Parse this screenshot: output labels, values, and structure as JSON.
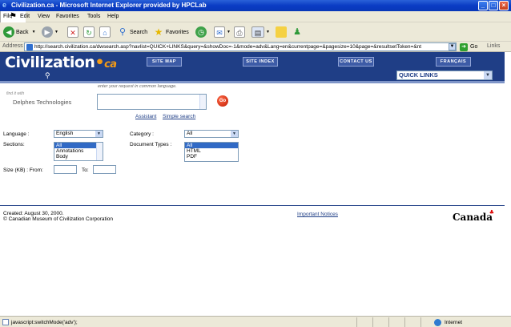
{
  "window": {
    "title": "Civilization.ca - Microsoft Internet Explorer provided by HPCLab"
  },
  "menu": [
    "File",
    "Edit",
    "View",
    "Favorites",
    "Tools",
    "Help"
  ],
  "toolbar": {
    "back": "Back",
    "search": "Search",
    "favorites": "Favorites"
  },
  "address": {
    "label": "Address",
    "url": "http://search.civilization.ca/dwsearch.asp?navlist=QUICK+LINKS&query=&showDoc=-1&mode=adv&Lang=en&currentpage=&pagesize=10&page=&resultsetToken=&nt",
    "go": "Go",
    "links": "Links"
  },
  "header": {
    "logo_main": "Civilization",
    "logo_suffix": "ca",
    "nav": [
      "SITE MAP",
      "SITE INDEX",
      "CONTACT US",
      "FRANÇAIS"
    ],
    "quick_links": "QUICK LINKS"
  },
  "search": {
    "find_it_with": "find it with",
    "brand": "Delphes Technologies",
    "prompt": "enter your request in common language.",
    "go_label": "Go",
    "assistant": "Assistant",
    "simple_search": "Simple search"
  },
  "filters": {
    "language_label": "Language :",
    "language_value": "English",
    "category_label": "Category :",
    "category_value": "All",
    "sections_label": "Sections:",
    "sections_options": [
      "All",
      "Annotations",
      "Body"
    ],
    "document_types_label": "Document Types :",
    "document_types_options": [
      "All",
      "HTML",
      "PDF"
    ],
    "size_label": "Size (KB) : From:",
    "to_label": "To:"
  },
  "footer": {
    "created": "Created: August 30, 2000.",
    "copyright": "© Canadian Museum of Civilization Corporation",
    "notices": "Important Notices",
    "canada": "Canada"
  },
  "status": {
    "text": "javascript:switchMode('adv');",
    "zone": "Internet"
  }
}
